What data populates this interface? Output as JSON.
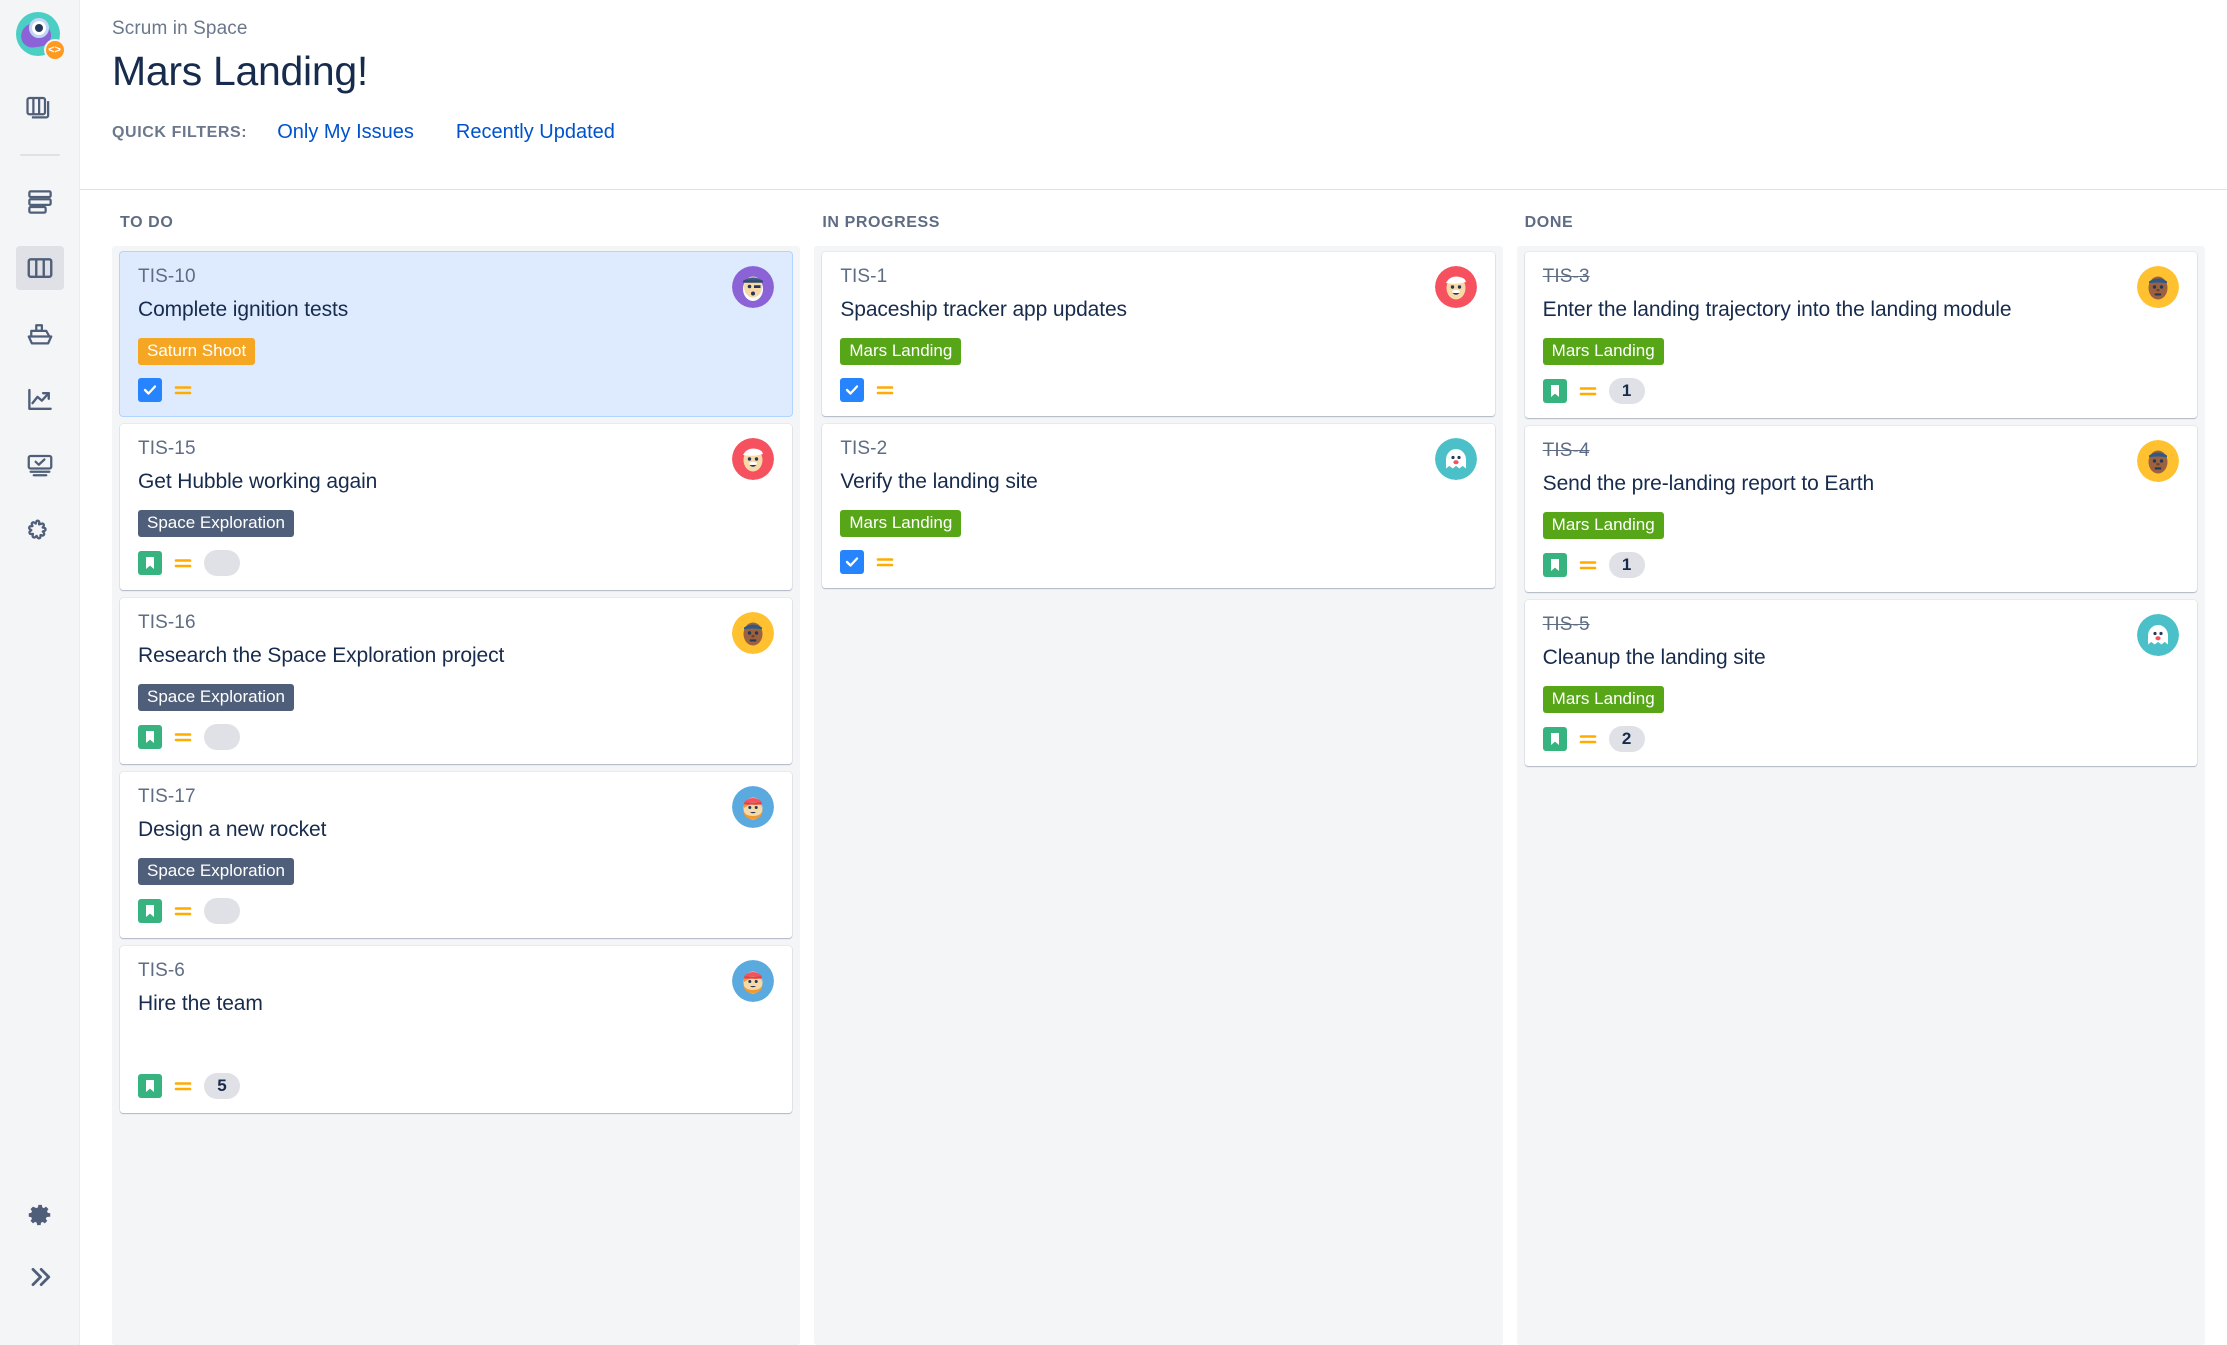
{
  "sidebar": {
    "logo": {
      "name": "scrum-in-space-logo",
      "badge": "<>"
    },
    "items": [
      {
        "name": "boards-stack-icon",
        "label": "Boards",
        "icon": "boards-stack-icon",
        "active": false
      },
      {
        "name": "backlog-icon",
        "label": "Backlog",
        "icon": "backlog-icon",
        "active": false
      },
      {
        "name": "active-sprints-icon",
        "label": "Active sprints",
        "icon": "board-columns-icon",
        "active": true
      },
      {
        "name": "releases-icon",
        "label": "Releases",
        "icon": "ship-icon",
        "active": false
      },
      {
        "name": "reports-icon",
        "label": "Reports",
        "icon": "chart-trend-icon",
        "active": false
      },
      {
        "name": "issues-icon",
        "label": "Issues",
        "icon": "monitor-check-icon",
        "active": false
      },
      {
        "name": "add-item-icon",
        "label": "Add item",
        "icon": "puzzle-icon",
        "active": false
      }
    ],
    "bottom_items": [
      {
        "name": "settings-icon",
        "label": "Project settings",
        "icon": "gear-icon"
      },
      {
        "name": "expand-sidebar-icon",
        "label": "Expand",
        "icon": "chevron-double-right-icon"
      }
    ]
  },
  "header": {
    "breadcrumb": "Scrum in Space",
    "title": "Mars Landing!",
    "quick_filters_label": "QUICK FILTERS:",
    "quick_filters": [
      {
        "label": "Only My Issues"
      },
      {
        "label": "Recently Updated"
      }
    ]
  },
  "colors": {
    "epic_saturn_shoot": "#f5a623",
    "epic_space_exploration": "#505f79",
    "epic_mars_landing": "#57a618",
    "type_task": "#2684ff",
    "type_story": "#36b37e",
    "priority_medium": "#ffab00",
    "link_blue": "#0052cc",
    "selected_card": "#deebff",
    "column_bg": "#f4f5f7"
  },
  "board": {
    "columns": [
      {
        "name": "todo",
        "title": "TO DO",
        "cards": [
          {
            "key": "TIS-10",
            "summary": "Complete ignition tests",
            "epic": "Saturn Shoot",
            "epic_color": "#f5a623",
            "type": "task",
            "priority": "medium",
            "estimate": "",
            "estimate_state": "hidden",
            "done": false,
            "selected": true,
            "avatar": "pirate-purple"
          },
          {
            "key": "TIS-15",
            "summary": "Get Hubble working again",
            "epic": "Space Exploration",
            "epic_color": "#505f79",
            "type": "story",
            "priority": "medium",
            "estimate": "",
            "estimate_state": "empty",
            "done": false,
            "selected": false,
            "avatar": "santa-red"
          },
          {
            "key": "TIS-16",
            "summary": "Research the Space Exploration project",
            "epic": "Space Exploration",
            "epic_color": "#505f79",
            "type": "story",
            "priority": "medium",
            "estimate": "",
            "estimate_state": "empty",
            "done": false,
            "selected": false,
            "avatar": "cap-yellow"
          },
          {
            "key": "TIS-17",
            "summary": "Design a new rocket",
            "epic": "Space Exploration",
            "epic_color": "#505f79",
            "type": "story",
            "priority": "medium",
            "estimate": "",
            "estimate_state": "empty",
            "done": false,
            "selected": false,
            "avatar": "beanie-blue"
          },
          {
            "key": "TIS-6",
            "summary": "Hire the team",
            "epic": "",
            "epic_color": "",
            "type": "story",
            "priority": "medium",
            "estimate": "5",
            "estimate_state": "value",
            "done": false,
            "selected": false,
            "avatar": "beanie-blue"
          }
        ]
      },
      {
        "name": "inprogress",
        "title": "IN PROGRESS",
        "cards": [
          {
            "key": "TIS-1",
            "summary": "Spaceship tracker app updates",
            "epic": "Mars Landing",
            "epic_color": "#57a618",
            "type": "task",
            "priority": "medium",
            "estimate": "",
            "estimate_state": "hidden",
            "done": false,
            "selected": false,
            "avatar": "santa-red"
          },
          {
            "key": "TIS-2",
            "summary": "Verify the landing site",
            "epic": "Mars Landing",
            "epic_color": "#57a618",
            "type": "task",
            "priority": "medium",
            "estimate": "",
            "estimate_state": "hidden",
            "done": false,
            "selected": false,
            "avatar": "ghost-teal"
          }
        ]
      },
      {
        "name": "done",
        "title": "DONE",
        "cards": [
          {
            "key": "TIS-3",
            "summary": "Enter the landing trajectory into the landing module",
            "epic": "Mars Landing",
            "epic_color": "#57a618",
            "type": "story",
            "priority": "medium",
            "estimate": "1",
            "estimate_state": "value",
            "done": true,
            "selected": false,
            "avatar": "cap-yellow"
          },
          {
            "key": "TIS-4",
            "summary": "Send the pre-landing report to Earth",
            "epic": "Mars Landing",
            "epic_color": "#57a618",
            "type": "story",
            "priority": "medium",
            "estimate": "1",
            "estimate_state": "value",
            "done": true,
            "selected": false,
            "avatar": "cap-yellow"
          },
          {
            "key": "TIS-5",
            "summary": "Cleanup the landing site",
            "epic": "Mars Landing",
            "epic_color": "#57a618",
            "type": "story",
            "priority": "medium",
            "estimate": "2",
            "estimate_state": "value",
            "done": true,
            "selected": false,
            "avatar": "ghost-teal"
          }
        ]
      }
    ]
  }
}
